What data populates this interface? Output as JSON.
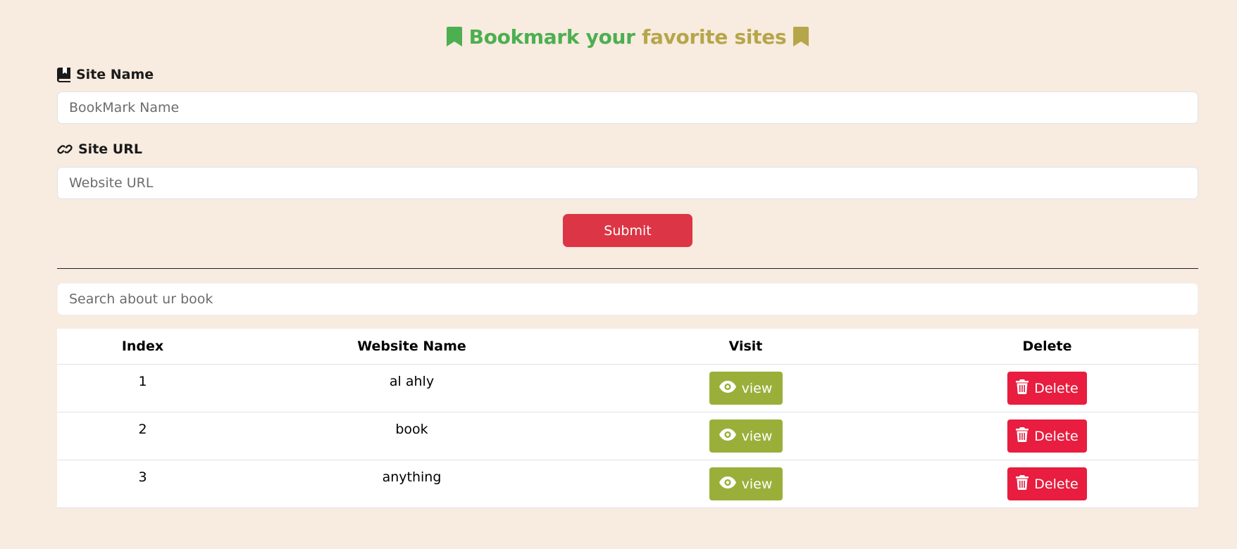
{
  "header": {
    "title_part1": "Bookmark your",
    "title_part2": "favorite sites"
  },
  "form": {
    "site_name_label": "Site Name",
    "site_name_placeholder": "BookMark Name",
    "site_url_label": "Site URL",
    "site_url_placeholder": "Website URL",
    "submit_label": "Submit"
  },
  "search": {
    "placeholder": "Search about ur book"
  },
  "table": {
    "headers": [
      "Index",
      "Website Name",
      "Visit",
      "Delete"
    ],
    "rows": [
      {
        "index": "1",
        "name": "al ahly",
        "visit": "view",
        "delete": "Delete"
      },
      {
        "index": "2",
        "name": "book",
        "visit": "view",
        "delete": "Delete"
      },
      {
        "index": "3",
        "name": "anything",
        "visit": "view",
        "delete": "Delete"
      }
    ]
  },
  "icons": {
    "title_left": "bookmark-icon",
    "title_right": "bookmark-icon",
    "site_name": "book-bookmark-icon",
    "site_url": "link-icon",
    "view": "eye-icon",
    "delete": "trash-icon"
  },
  "colors": {
    "background": "#f8ebdf",
    "title_green": "#4caf50",
    "title_olive": "#b5a64a",
    "submit": "#dc3545",
    "view_button": "#9aaf3a",
    "delete_button": "#e81d3f"
  }
}
